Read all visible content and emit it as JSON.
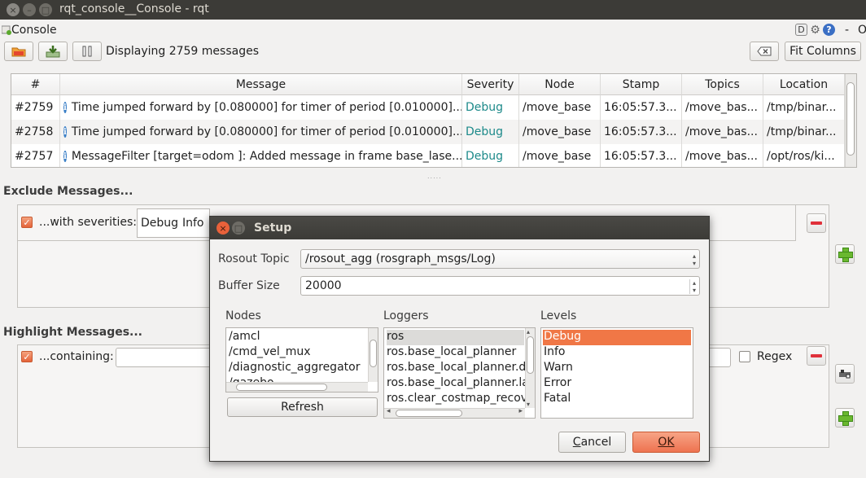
{
  "window": {
    "title": "rqt_console__Console - rqt",
    "close": "×",
    "min": "–",
    "max": "□"
  },
  "plugin": {
    "title": "Console",
    "corner_d": "D",
    "gear": "⚙",
    "help": "?",
    "dash": "-",
    "o": "O"
  },
  "toolbar": {
    "status": "Displaying 2759 messages",
    "fit_columns": "Fit Columns"
  },
  "table": {
    "headers": [
      "#",
      "Message",
      "Severity",
      "Node",
      "Stamp",
      "Topics",
      "Location"
    ],
    "rows": [
      {
        "num": "#2759",
        "message": "Time jumped forward by [0.080000] for timer of period [0.010000]...",
        "severity": "Debug",
        "node": "/move_base",
        "stamp": "16:05:57.3...",
        "topics": "/move_bas...",
        "location": "/tmp/binar..."
      },
      {
        "num": "#2758",
        "message": "Time jumped forward by [0.080000] for timer of period [0.010000]...",
        "severity": "Debug",
        "node": "/move_base",
        "stamp": "16:05:57.3...",
        "topics": "/move_bas...",
        "location": "/tmp/binar..."
      },
      {
        "num": "#2757",
        "message": "MessageFilter [target=odom ]: Added message in frame base_lase...",
        "severity": "Debug",
        "node": "/move_base",
        "stamp": "16:05:57.3...",
        "topics": "/move_bas...",
        "location": "/opt/ros/ki..."
      }
    ],
    "info_glyph": "i",
    "splitter": "....."
  },
  "exclude": {
    "title": "Exclude Messages...",
    "with_severities": "...with severities:",
    "sev_debug": "Debug",
    "sev_info": "Info"
  },
  "highlight": {
    "title": "Highlight Messages...",
    "containing": "...containing:",
    "regex": "Regex"
  },
  "dialog": {
    "title": "Setup",
    "rosout_topic_label": "Rosout Topic",
    "rosout_topic_value": "/rosout_agg (rosgraph_msgs/Log)",
    "buffer_size_label": "Buffer Size",
    "buffer_size_value": "20000",
    "nodes_label": "Nodes",
    "nodes": [
      "/amcl",
      "/cmd_vel_mux",
      "/diagnostic_aggregator",
      "/gazebo"
    ],
    "loggers_label": "Loggers",
    "loggers": [
      "ros",
      "ros.base_local_planner",
      "ros.base_local_planner.dw",
      "ros.base_local_planner.la",
      "ros.clear_costmap_recov"
    ],
    "levels_label": "Levels",
    "levels": [
      "Debug",
      "Info",
      "Warn",
      "Error",
      "Fatal"
    ],
    "refresh": "Refresh",
    "cancel_first": "C",
    "cancel_rest": "ancel",
    "ok_first": "O",
    "ok_rest": "K",
    "arrow_up": "▴",
    "arrow_down": "▾",
    "arrow_left": "◂",
    "arrow_right": "▸"
  },
  "colors": {
    "accent": "#f07746",
    "titlebar": "#3c3b37",
    "severity_text": "#1d8a8a",
    "info_icon": "#3a7fc7"
  },
  "icons": [
    "open-folder-icon",
    "save-icon",
    "pause-icon",
    "clear-icon",
    "info-icon",
    "checkbox-checked-icon",
    "remove-icon",
    "add-icon",
    "highlight-settings-icon",
    "gear-icon",
    "help-icon"
  ]
}
